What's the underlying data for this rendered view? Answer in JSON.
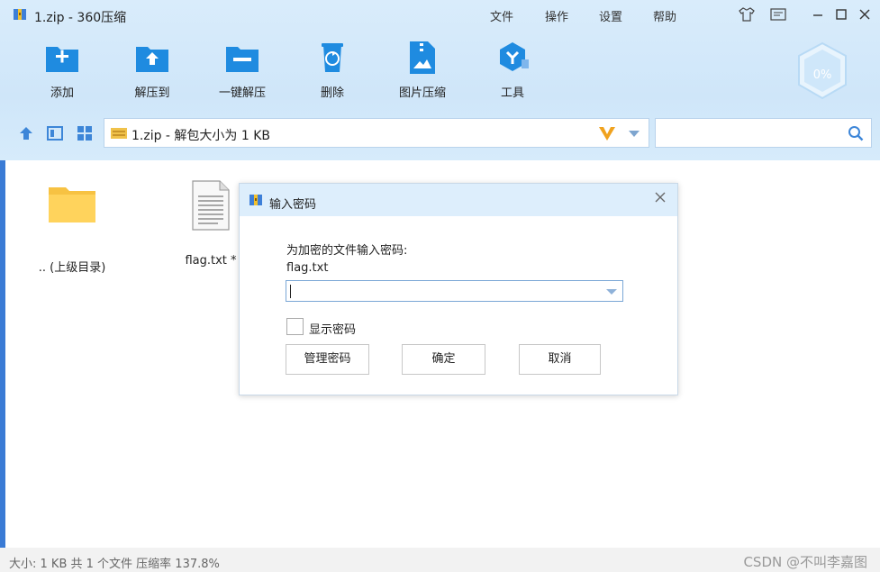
{
  "window": {
    "title": "1.zip - 360压缩",
    "menus": [
      "文件",
      "操作",
      "设置",
      "帮助"
    ]
  },
  "toolbar": {
    "items": [
      {
        "label": "添加",
        "icon": "add-folder-icon"
      },
      {
        "label": "解压到",
        "icon": "extract-to-icon"
      },
      {
        "label": "一键解压",
        "icon": "one-click-extract-icon"
      },
      {
        "label": "删除",
        "icon": "recycle-bin-icon"
      },
      {
        "label": "图片压缩",
        "icon": "image-compress-icon"
      },
      {
        "label": "工具",
        "icon": "tools-icon"
      }
    ],
    "badge_text": "0%"
  },
  "address": {
    "path": "1.zip - 解包大小为 1 KB",
    "search_placeholder": ""
  },
  "files": [
    {
      "label": ".. (上级目录)",
      "icon": "folder-icon"
    },
    {
      "label": "flag.txt *",
      "icon": "text-file-icon"
    }
  ],
  "status": {
    "text": "大小: 1 KB 共 1 个文件 压缩率 137.8%",
    "watermark": "CSDN @不叫李嘉图"
  },
  "dialog": {
    "title": "输入密码",
    "prompt": "为加密的文件输入密码:",
    "filename": "flag.txt",
    "password_value": "",
    "show_password_label": "显示密码",
    "manage_button": "管理密码",
    "ok_button": "确定",
    "cancel_button": "取消"
  },
  "colors": {
    "accent": "#1f8be0",
    "header_bg": "#d9ecfb",
    "dialog_header": "#ddeefc"
  }
}
